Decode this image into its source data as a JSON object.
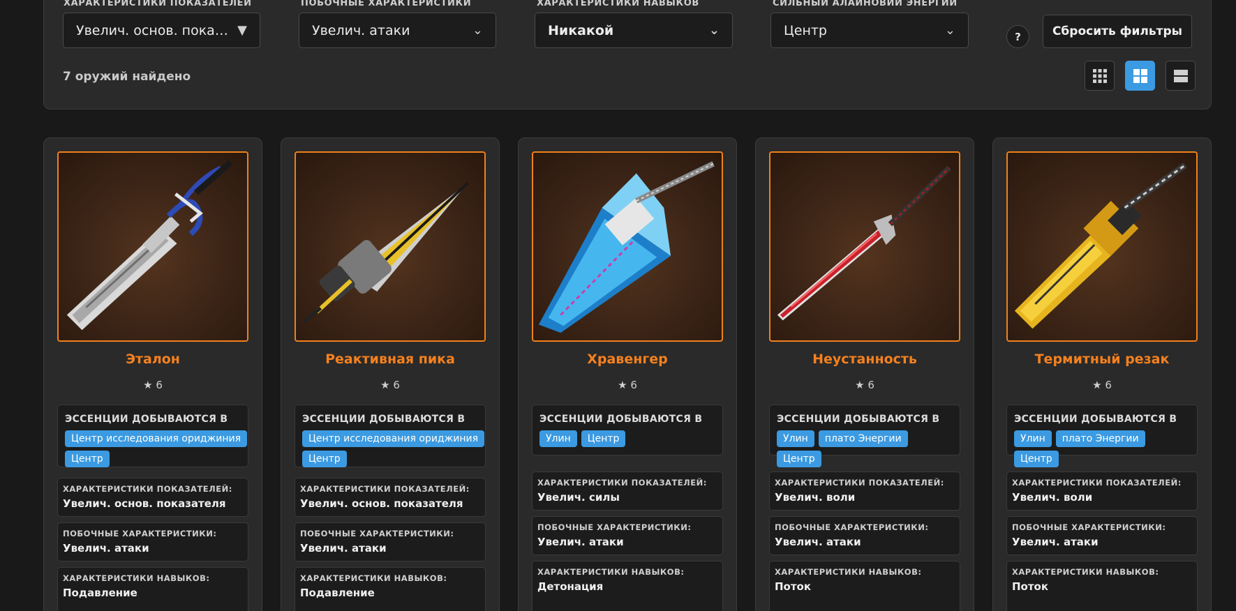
{
  "filters": {
    "main_stats": {
      "label": "Характеристики показателей",
      "value": "Увелич. основ. показателя,..."
    },
    "sub_stats": {
      "label": "Побочные характеристики",
      "value": "Увелич. атаки"
    },
    "skill_stats": {
      "label": "Характеристики навыков",
      "value": "Никакой"
    },
    "energy": {
      "label": "Сильный алайновий энергии",
      "value": "Центр"
    },
    "help_label": "?",
    "reset_label": "Сбросить фильтры"
  },
  "results_count": "7 оружий найдено",
  "view_modes": [
    "grid-small-icon",
    "grid-large-icon",
    "list-icon"
  ],
  "active_view": "grid-large-icon",
  "labels": {
    "essence": "ЭССЕНЦИИ ДОБЫВАЮТСЯ В",
    "main": "ХАРАКТЕРИСТИКИ ПОКАЗАТЕЛЕЙ:",
    "sub": "ПОБОЧНЫЕ ХАРАКТЕРИСТИКИ:",
    "skill": "ХАРАКТЕРИСТИКИ НАВЫКОВ:"
  },
  "colors": {
    "accent": "#f5811f",
    "tag": "#3b9ae1",
    "panel": "#2a2a2a",
    "bg": "#191919"
  },
  "weapons": [
    {
      "name": "Эталон",
      "rarity": "★ 6",
      "locations": [
        "Центр исследования ориджиния",
        "Центр"
      ],
      "main": "Увелич. основ. показателя",
      "sub": "Увелич. атаки",
      "skill": "Подавление"
    },
    {
      "name": "Реактивная пика",
      "rarity": "★ 6",
      "locations": [
        "Центр исследования ориджиния",
        "Центр"
      ],
      "main": "Увелич. основ. показателя",
      "sub": "Увелич. атаки",
      "skill": "Подавление"
    },
    {
      "name": "Хравенгер",
      "rarity": "★ 6",
      "locations": [
        "Улин",
        "Центр"
      ],
      "main": "Увелич. силы",
      "sub": "Увелич. атаки",
      "skill": "Детонация"
    },
    {
      "name": "Неустанность",
      "rarity": "★ 6",
      "locations": [
        "Улин",
        "плато Энергии",
        "Центр"
      ],
      "main": "Увелич. воли",
      "sub": "Увелич. атаки",
      "skill": "Поток"
    },
    {
      "name": "Термитный резак",
      "rarity": "★ 6",
      "locations": [
        "Улин",
        "плато Энергии",
        "Центр"
      ],
      "main": "Увелич. воли",
      "sub": "Увелич. атаки",
      "skill": "Поток"
    }
  ]
}
